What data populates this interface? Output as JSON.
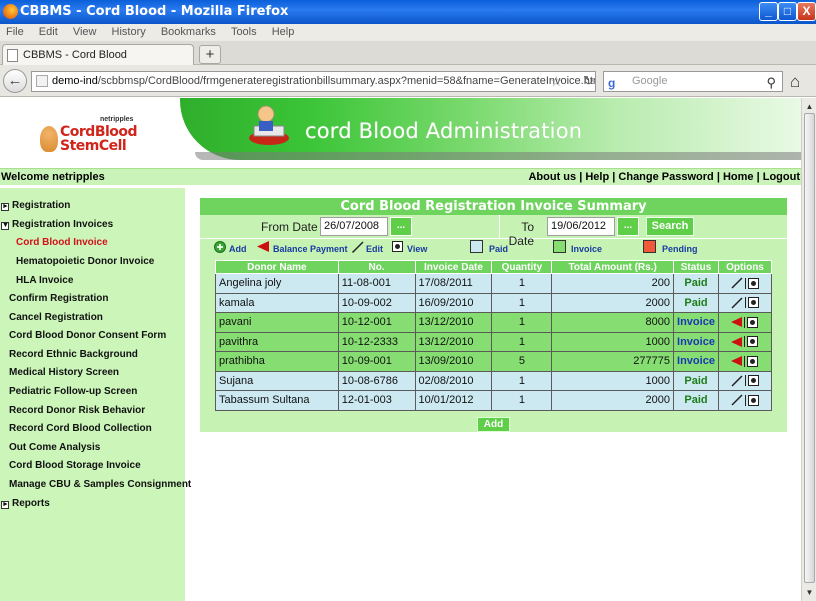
{
  "window": {
    "title": "CBBMS - Cord Blood - Mozilla Firefox",
    "controls": [
      "_",
      "□",
      "X"
    ]
  },
  "browser": {
    "menu": [
      "File",
      "Edit",
      "View",
      "History",
      "Bookmarks",
      "Tools",
      "Help"
    ],
    "tab_title": "CBBMS - Cord Blood",
    "new_tab": "+",
    "url_domain": "demo-ind",
    "url_path": "/scbbmsp/CordBlood/frmgenerateregistrationbillsummary.aspx?menid=58&fname=GenerateInvoice.htm",
    "search_placeholder": "Google"
  },
  "banner": {
    "logo_top": "netripples",
    "logo_line1": "CordBlood",
    "logo_line2": "StemCell",
    "title": "cord Blood Administration"
  },
  "welcome": "Welcome netripples",
  "toplinks": [
    "About us",
    "Help",
    "Change Password",
    "Home",
    "Logout"
  ],
  "sidebar": {
    "items": [
      {
        "label": "Registration",
        "box": "+",
        "level": 0
      },
      {
        "label": "Registration Invoices",
        "box": "-",
        "level": 0
      },
      {
        "label": "Cord Blood Invoice",
        "level": 2,
        "active": true
      },
      {
        "label": "Hematopoietic Donor Invoice",
        "level": 2
      },
      {
        "label": "HLA Invoice",
        "level": 2
      },
      {
        "label": "Confirm Registration",
        "level": 1
      },
      {
        "label": "Cancel Registration",
        "level": 1
      },
      {
        "label": "Cord Blood Donor Consent Form",
        "level": 1
      },
      {
        "label": "Record Ethnic Background",
        "level": 1
      },
      {
        "label": "Medical History Screen",
        "level": 1
      },
      {
        "label": "Pediatric Follow-up Screen",
        "level": 1
      },
      {
        "label": "Record Donor Risk Behavior",
        "level": 1
      },
      {
        "label": "Record Cord Blood Collection",
        "level": 1
      },
      {
        "label": "Out Come Analysis",
        "level": 1
      },
      {
        "label": "Cord Blood Storage Invoice",
        "level": 1
      },
      {
        "label": "Manage CBU & Samples Consignment",
        "level": 1
      },
      {
        "label": "Reports",
        "box": "+",
        "level": 0
      }
    ]
  },
  "summary": {
    "title": "Cord Blood Registration Invoice Summary",
    "from_label": "From Date",
    "from_value": "26/07/2008",
    "to_label": "To Date",
    "to_value": "19/06/2012",
    "picker_label": "...",
    "search_label": "Search",
    "legend": {
      "add": "Add",
      "balance_payment": "Balance Payment",
      "edit": "Edit",
      "view": "View",
      "paid": "Paid",
      "invoice": "Invoice",
      "pending": "Pending",
      "paid_color": "#cce9f2",
      "invoice_color": "#86de72",
      "pending_color": "#f05a3a"
    },
    "columns": [
      "Donor Name",
      "No.",
      "Invoice Date",
      "Quantity",
      "Total Amount (Rs.)",
      "Status",
      "Options"
    ],
    "rows": [
      {
        "name": "Angelina joly",
        "no": "11-08-001",
        "date": "17/08/2011",
        "qty": "1",
        "amount": "200",
        "status": "Paid"
      },
      {
        "name": "kamala",
        "no": "10-09-002",
        "date": "16/09/2010",
        "qty": "1",
        "amount": "2000",
        "status": "Paid"
      },
      {
        "name": "pavani",
        "no": "10-12-001",
        "date": "13/12/2010",
        "qty": "1",
        "amount": "8000",
        "status": "Invoice"
      },
      {
        "name": "pavithra",
        "no": "10-12-2333",
        "date": "13/12/2010",
        "qty": "1",
        "amount": "1000",
        "status": "Invoice"
      },
      {
        "name": "prathibha",
        "no": "10-09-001",
        "date": "13/09/2010",
        "qty": "5",
        "amount": "277775",
        "status": "Invoice"
      },
      {
        "name": "Sujana",
        "no": "10-08-6786",
        "date": "02/08/2010",
        "qty": "1",
        "amount": "1000",
        "status": "Paid"
      },
      {
        "name": "Tabassum Sultana",
        "no": "12-01-003",
        "date": "10/01/2012",
        "qty": "1",
        "amount": "2000",
        "status": "Paid"
      }
    ],
    "add_button": "Add"
  }
}
